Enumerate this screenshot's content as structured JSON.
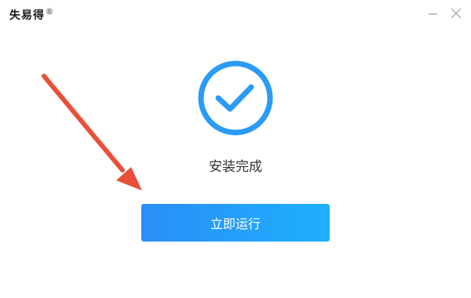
{
  "window": {
    "app_name": "失易得",
    "registered_mark": "®",
    "controls": {
      "minimize_icon": "minimize-icon",
      "close_icon": "close-icon"
    }
  },
  "main": {
    "status_icon": "checkmark-circle-icon",
    "status_text": "安装完成",
    "run_button_label": "立即运行"
  },
  "annotation": {
    "icon": "red-arrow-icon"
  },
  "colors": {
    "accent": "#2a9bf6",
    "button_gradient_start": "#2a8ef7",
    "button_gradient_end": "#1fb0fd",
    "arrow": "#e9503a",
    "text": "#333333"
  }
}
